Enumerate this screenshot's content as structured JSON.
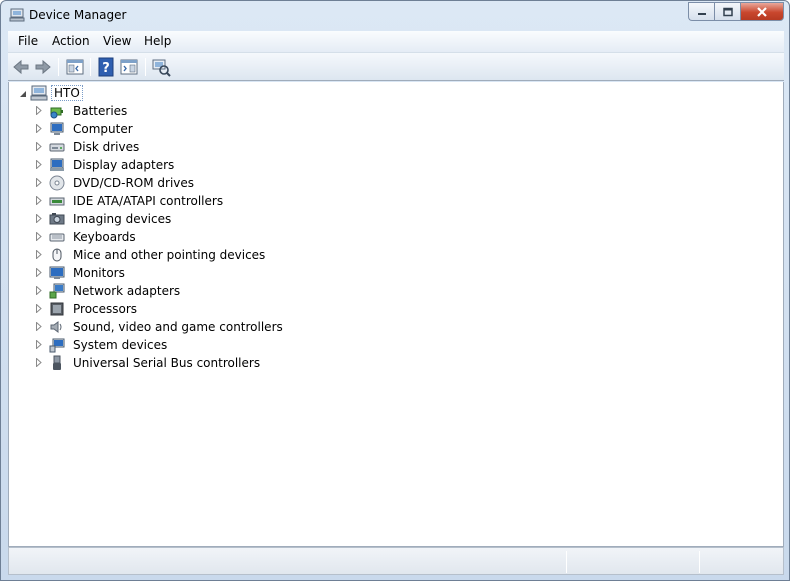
{
  "window": {
    "title": "Device Manager"
  },
  "menu": [
    "File",
    "Action",
    "View",
    "Help"
  ],
  "toolbar": {
    "buttons": [
      "back-icon",
      "forward-icon",
      "console-tree-icon",
      "help-icon",
      "action-pane-icon",
      "scan-hardware-icon"
    ]
  },
  "tree": {
    "root": {
      "label": "HTO",
      "icon": "computer-icon"
    },
    "items": [
      {
        "label": "Batteries",
        "icon": "battery-icon"
      },
      {
        "label": "Computer",
        "icon": "computer-monitor-icon"
      },
      {
        "label": "Disk drives",
        "icon": "disk-drive-icon"
      },
      {
        "label": "Display adapters",
        "icon": "display-adapter-icon"
      },
      {
        "label": "DVD/CD-ROM drives",
        "icon": "dvd-icon"
      },
      {
        "label": "IDE ATA/ATAPI controllers",
        "icon": "ide-controller-icon"
      },
      {
        "label": "Imaging devices",
        "icon": "camera-icon"
      },
      {
        "label": "Keyboards",
        "icon": "keyboard-icon"
      },
      {
        "label": "Mice and other pointing devices",
        "icon": "mouse-icon"
      },
      {
        "label": "Monitors",
        "icon": "monitor-icon"
      },
      {
        "label": "Network adapters",
        "icon": "network-adapter-icon"
      },
      {
        "label": "Processors",
        "icon": "processor-icon"
      },
      {
        "label": "Sound, video and game controllers",
        "icon": "speaker-icon"
      },
      {
        "label": "System devices",
        "icon": "system-devices-icon"
      },
      {
        "label": "Universal Serial Bus controllers",
        "icon": "usb-icon"
      }
    ]
  },
  "statusbar": {
    "text": ""
  },
  "colors": {
    "title_bg": "#dce8f5",
    "close_red": "#c9472e",
    "selection_border": "#7a9cc8"
  }
}
